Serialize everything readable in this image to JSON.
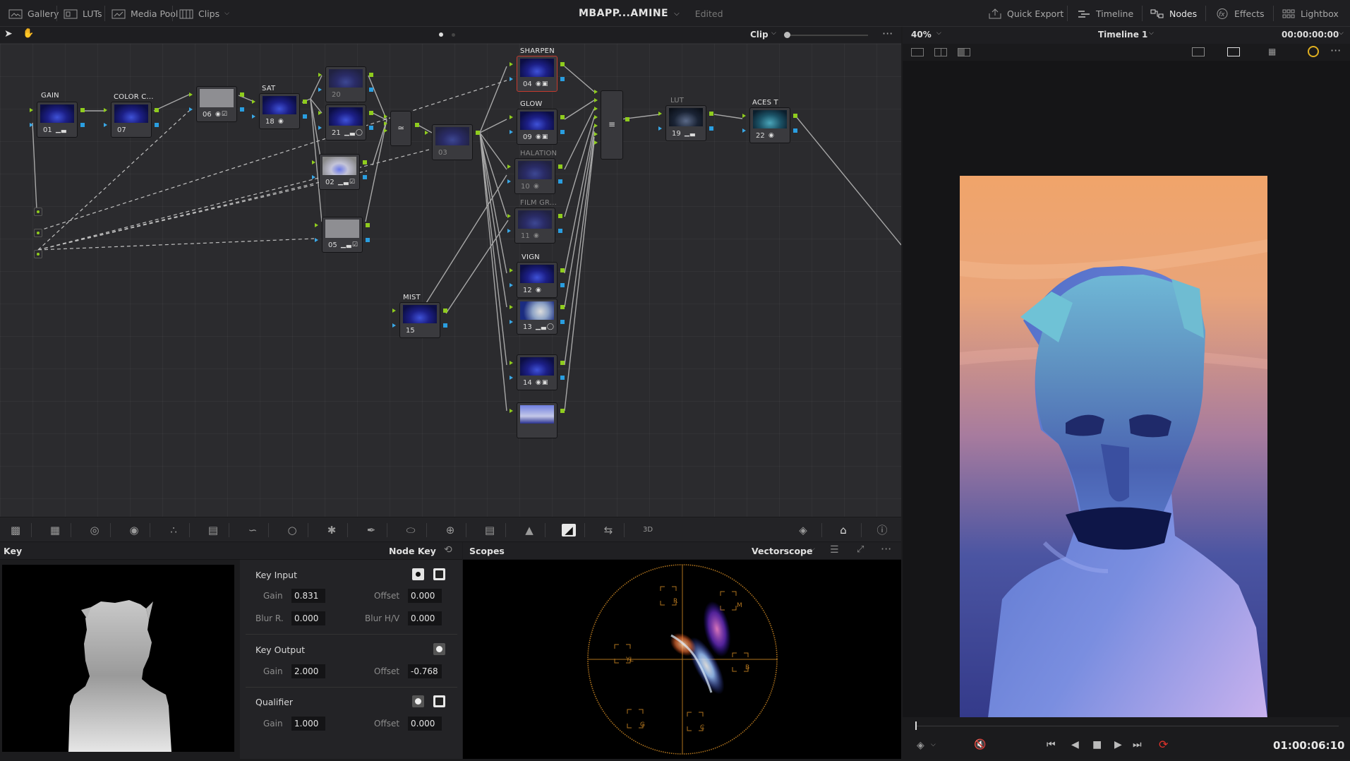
{
  "topbar": {
    "gallery": "Gallery",
    "luts": "LUTs",
    "media_pool": "Media Pool",
    "clips": "Clips",
    "project_name": "MBAPP...AMINE",
    "edited": "Edited",
    "quick_export": "Quick Export",
    "timeline": "Timeline",
    "nodes": "Nodes",
    "effects": "Effects",
    "lightbox": "Lightbox"
  },
  "node_bar": {
    "mode": "Clip"
  },
  "viewer_bar": {
    "zoom": "40%",
    "timeline": "Timeline 1",
    "timecode": "00:00:00:00"
  },
  "nodes": {
    "gain": {
      "label": "GAIN",
      "num": "01"
    },
    "colorc": {
      "label": "COLOR C...",
      "num": "07"
    },
    "n06": {
      "num": "06"
    },
    "sat": {
      "label": "SAT",
      "num": "18"
    },
    "n20": {
      "num": "20"
    },
    "n21": {
      "num": "21"
    },
    "n02": {
      "num": "02"
    },
    "n05": {
      "num": "05"
    },
    "n03": {
      "num": "03"
    },
    "mist": {
      "label": "MIST",
      "num": "15"
    },
    "sharpen": {
      "label": "SHARPEN",
      "num": "04"
    },
    "glow": {
      "label": "GLOW",
      "num": "09"
    },
    "halation": {
      "label": "HALATION",
      "num": "10"
    },
    "filmgr": {
      "label": "FILM GR...",
      "num": "11"
    },
    "vign": {
      "label": "VIGN",
      "num": "12"
    },
    "n13": {
      "num": "13"
    },
    "n14": {
      "num": "14"
    },
    "lut": {
      "label": "LUT",
      "num": "19"
    },
    "aces": {
      "label": "ACES T",
      "num": "22"
    }
  },
  "key_panel": {
    "title": "Key",
    "mode": "Node Key",
    "key_input": {
      "label": "Key Input",
      "gain_label": "Gain",
      "gain": "0.831",
      "offset_label": "Offset",
      "offset": "0.000",
      "blur_r_label": "Blur R.",
      "blur_r": "0.000",
      "blur_hv_label": "Blur H/V",
      "blur_hv": "0.000"
    },
    "key_output": {
      "label": "Key Output",
      "gain_label": "Gain",
      "gain": "2.000",
      "offset_label": "Offset",
      "offset": "-0.768"
    },
    "qualifier": {
      "label": "Qualifier",
      "gain_label": "Gain",
      "gain": "1.000",
      "offset_label": "Offset",
      "offset": "0.000"
    }
  },
  "scopes": {
    "title": "Scopes",
    "type": "Vectorscope",
    "targets": [
      "R",
      "M",
      "B",
      "C",
      "G",
      "YL"
    ]
  },
  "playback": {
    "timecode": "01:00:06:10"
  },
  "colors": {
    "connector_green": "#8fcc1e",
    "connector_blue": "#2a9ee0",
    "selected_red": "#c63a2e",
    "loop_red": "#e0322a"
  }
}
